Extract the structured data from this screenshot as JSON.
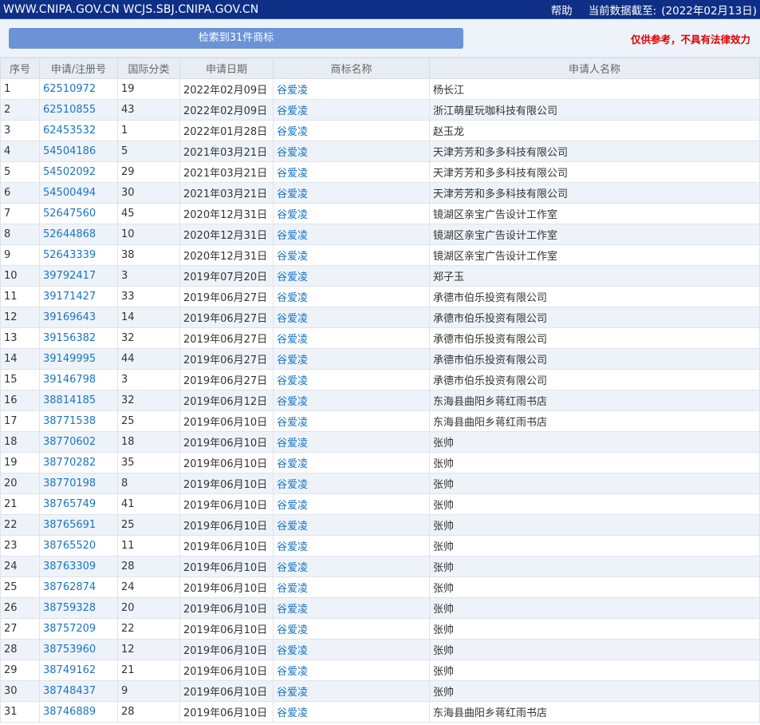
{
  "header": {
    "site": "WWW.CNIPA.GOV.CN WCJS.SBJ.CNIPA.GOV.CN",
    "help": "帮助",
    "date_label": "当前数据截至:",
    "date_value": "(2022年02月13日)"
  },
  "search": {
    "result_label": "检索到31件商标",
    "disclaimer": "仅供参考，不具有法律效力"
  },
  "table": {
    "headers": [
      "序号",
      "申请/注册号",
      "国际分类",
      "申请日期",
      "商标名称",
      "申请人名称"
    ],
    "rows": [
      [
        "1",
        "62510972",
        "19",
        "2022年02月09日",
        "谷爱凌",
        "杨长江"
      ],
      [
        "2",
        "62510855",
        "43",
        "2022年02月09日",
        "谷爱凌",
        "浙江萌星玩咖科技有限公司"
      ],
      [
        "3",
        "62453532",
        "1",
        "2022年01月28日",
        "谷爱凌",
        "赵玉龙"
      ],
      [
        "4",
        "54504186",
        "5",
        "2021年03月21日",
        "谷爱凌",
        "天津芳芳和多多科技有限公司"
      ],
      [
        "5",
        "54502092",
        "29",
        "2021年03月21日",
        "谷爱凌",
        "天津芳芳和多多科技有限公司"
      ],
      [
        "6",
        "54500494",
        "30",
        "2021年03月21日",
        "谷爱凌",
        "天津芳芳和多多科技有限公司"
      ],
      [
        "7",
        "52647560",
        "45",
        "2020年12月31日",
        "谷爱凌",
        "镜湖区亲宝广告设计工作室"
      ],
      [
        "8",
        "52644868",
        "10",
        "2020年12月31日",
        "谷爱凌",
        "镜湖区亲宝广告设计工作室"
      ],
      [
        "9",
        "52643339",
        "38",
        "2020年12月31日",
        "谷爱凌",
        "镜湖区亲宝广告设计工作室"
      ],
      [
        "10",
        "39792417",
        "3",
        "2019年07月20日",
        "谷爱凌",
        "郑子玉"
      ],
      [
        "11",
        "39171427",
        "33",
        "2019年06月27日",
        "谷爱凌",
        "承德市伯乐投资有限公司"
      ],
      [
        "12",
        "39169643",
        "14",
        "2019年06月27日",
        "谷爱凌",
        "承德市伯乐投资有限公司"
      ],
      [
        "13",
        "39156382",
        "32",
        "2019年06月27日",
        "谷爱凌",
        "承德市伯乐投资有限公司"
      ],
      [
        "14",
        "39149995",
        "44",
        "2019年06月27日",
        "谷爱凌",
        "承德市伯乐投资有限公司"
      ],
      [
        "15",
        "39146798",
        "3",
        "2019年06月27日",
        "谷爱凌",
        "承德市伯乐投资有限公司"
      ],
      [
        "16",
        "38814185",
        "32",
        "2019年06月12日",
        "谷爱凌",
        "东海县曲阳乡蒋红雨书店"
      ],
      [
        "17",
        "38771538",
        "25",
        "2019年06月10日",
        "谷爱凌",
        "东海县曲阳乡蒋红雨书店"
      ],
      [
        "18",
        "38770602",
        "18",
        "2019年06月10日",
        "谷爱凌",
        "张帅"
      ],
      [
        "19",
        "38770282",
        "35",
        "2019年06月10日",
        "谷爱凌",
        "张帅"
      ],
      [
        "20",
        "38770198",
        "8",
        "2019年06月10日",
        "谷爱凌",
        "张帅"
      ],
      [
        "21",
        "38765749",
        "41",
        "2019年06月10日",
        "谷爱凌",
        "张帅"
      ],
      [
        "22",
        "38765691",
        "25",
        "2019年06月10日",
        "谷爱凌",
        "张帅"
      ],
      [
        "23",
        "38765520",
        "11",
        "2019年06月10日",
        "谷爱凌",
        "张帅"
      ],
      [
        "24",
        "38763309",
        "28",
        "2019年06月10日",
        "谷爱凌",
        "张帅"
      ],
      [
        "25",
        "38762874",
        "24",
        "2019年06月10日",
        "谷爱凌",
        "张帅"
      ],
      [
        "26",
        "38759328",
        "20",
        "2019年06月10日",
        "谷爱凌",
        "张帅"
      ],
      [
        "27",
        "38757209",
        "22",
        "2019年06月10日",
        "谷爱凌",
        "张帅"
      ],
      [
        "28",
        "38753960",
        "12",
        "2019年06月10日",
        "谷爱凌",
        "张帅"
      ],
      [
        "29",
        "38749162",
        "21",
        "2019年06月10日",
        "谷爱凌",
        "张帅"
      ],
      [
        "30",
        "38748437",
        "9",
        "2019年06月10日",
        "谷爱凌",
        "张帅"
      ],
      [
        "31",
        "38746889",
        "28",
        "2019年06月10日",
        "谷爱凌",
        "东海县曲阳乡蒋红雨书店"
      ]
    ]
  }
}
